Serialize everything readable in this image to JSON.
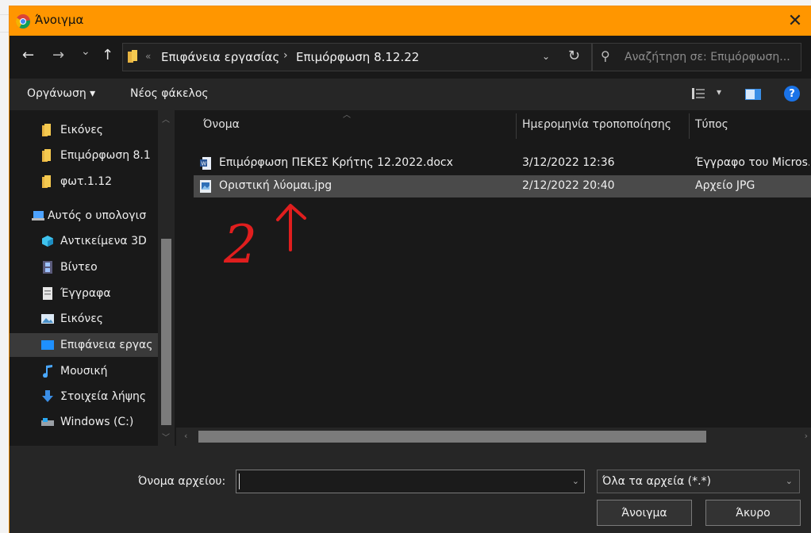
{
  "window": {
    "title": "Άνοιγμα",
    "close_glyph": "✕",
    "accent": "#ff9600"
  },
  "nav": {
    "back_glyph": "←",
    "forward_glyph": "→",
    "recent_glyph": "⌄",
    "up_glyph": "↑",
    "breadcrumbs": [
      "Επιφάνεια εργασίας",
      "Επιμόρφωση 8.12.22"
    ],
    "separator_small": "«",
    "crumb_separator": "›",
    "refresh_glyph": "↻",
    "search_placeholder": "Αναζήτηση σε: Επιμόρφωση..."
  },
  "toolbar": {
    "organize_label": "Οργάνωση ▾",
    "new_folder_label": "Νέος φάκελος",
    "help_glyph": "?"
  },
  "sidebar": {
    "items": [
      {
        "label": "Εικόνες",
        "icon": "folder-icon"
      },
      {
        "label": "Επιμόρφωση 8.1",
        "icon": "folder-icon"
      },
      {
        "label": "φωτ.1.12",
        "icon": "folder-icon"
      },
      {
        "label": "Αυτός ο υπολογισ",
        "icon": "computer-icon"
      },
      {
        "label": "Αντικείμενα 3D",
        "icon": "cube-icon"
      },
      {
        "label": "Βίντεο",
        "icon": "film-icon"
      },
      {
        "label": "Έγγραφα",
        "icon": "document-icon"
      },
      {
        "label": "Εικόνες",
        "icon": "picture-icon"
      },
      {
        "label": "Επιφάνεια εργας",
        "icon": "desktop-icon"
      },
      {
        "label": "Μουσική",
        "icon": "music-icon"
      },
      {
        "label": "Στοιχεία λήψης",
        "icon": "download-icon"
      },
      {
        "label": "Windows (C:)",
        "icon": "drive-icon"
      }
    ]
  },
  "filelist": {
    "columns": [
      "Όνομα",
      "Ημερομηνία τροποποίησης",
      "Τύπος"
    ],
    "rows": [
      {
        "name": "Επιμόρφωση ΠΕΚΕΣ Κρήτης 12.2022.docx",
        "date": "3/12/2022 12:36",
        "type": "Έγγραφο του Micros...",
        "icon": "word-doc-icon",
        "selected": false
      },
      {
        "name": "Οριστική λύομαι.jpg",
        "date": "2/12/2022 20:40",
        "type": "Αρχείο JPG",
        "icon": "image-file-icon",
        "selected": true
      }
    ]
  },
  "annotation": {
    "text": "2",
    "color": "#e01e1e"
  },
  "bottom": {
    "filename_label": "Όνομα αρχείου:",
    "filename_value": "",
    "filetype_value": "Όλα τα αρχεία (*.*)",
    "open_label": "Άνοιγμα",
    "cancel_label": "Άκυρο"
  }
}
